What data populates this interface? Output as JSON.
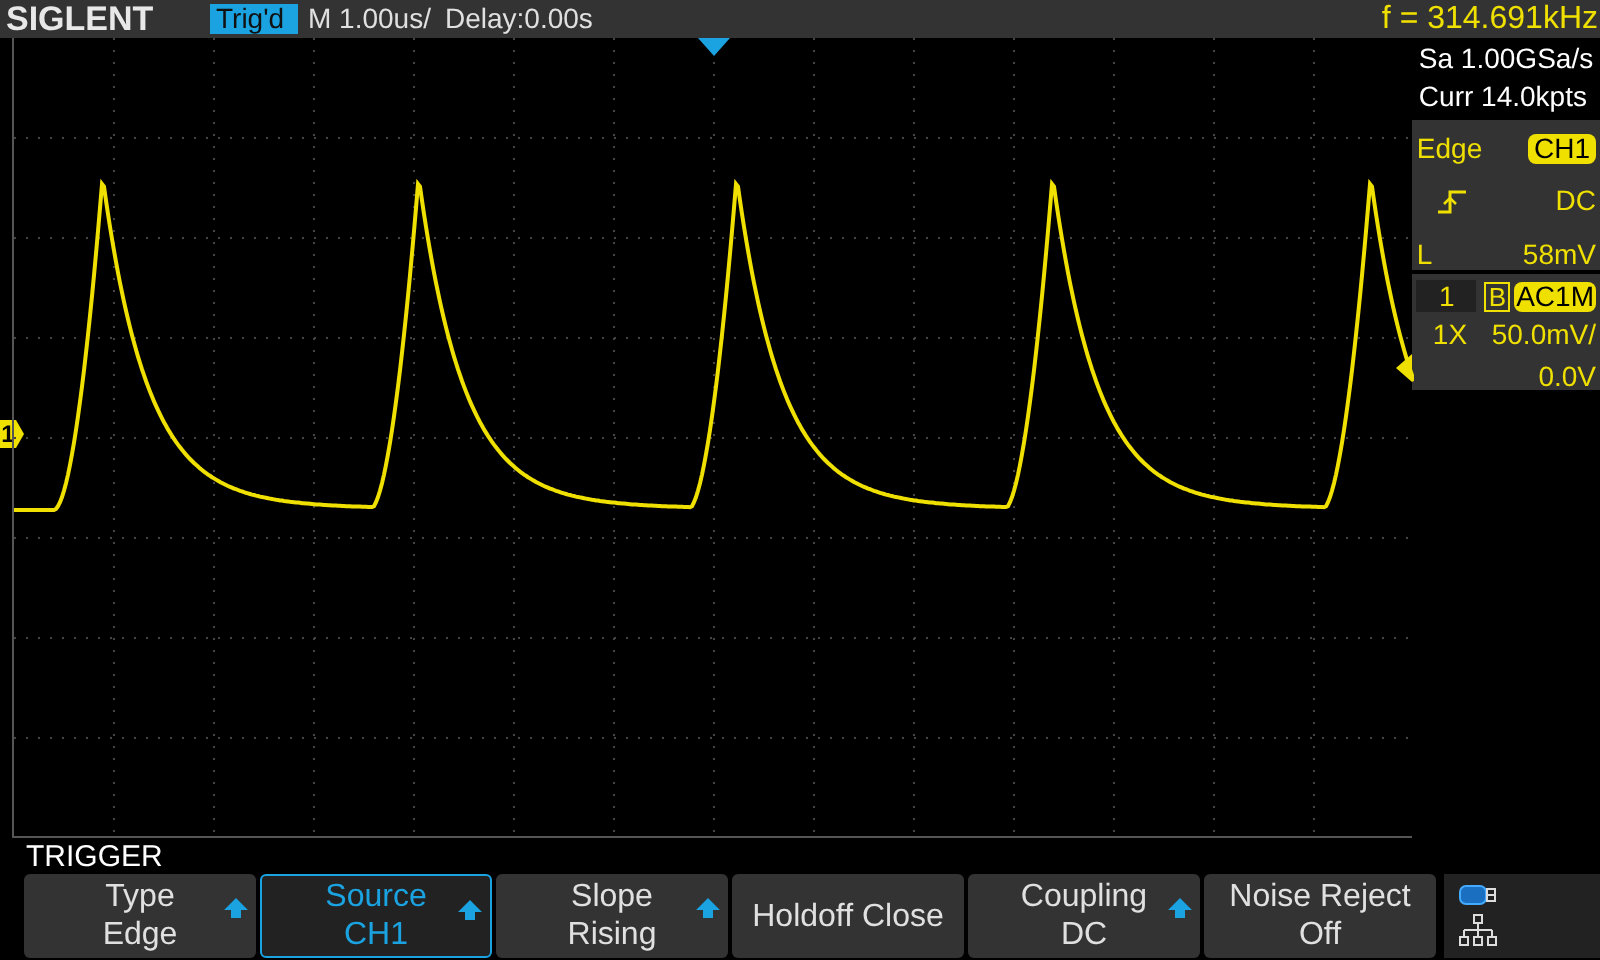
{
  "header": {
    "logo": "SIGLENT",
    "status": "Trig'd",
    "timebase": "M 1.00us/",
    "delay": "Delay:0.00s",
    "frequency": "f = 314.691kHz"
  },
  "acquisition": {
    "sample_rate": "Sa 1.00GSa/s",
    "memory": "Curr 14.0kpts"
  },
  "trigger": {
    "type": "Edge",
    "source": "CH1",
    "coupling": "DC",
    "level_label": "L",
    "level_reading": "58mV"
  },
  "channel": {
    "number": "1",
    "bandwidth_limit": "B",
    "coupling": "AC1M",
    "probe": "1X",
    "scale": "50.0mV/",
    "offset": "0.0V"
  },
  "ground_marker": "1",
  "menu": {
    "title": "TRIGGER",
    "softkeys": [
      {
        "label": "Type",
        "value": "Edge",
        "arrow": true,
        "selected": false
      },
      {
        "label": "Source",
        "value": "CH1",
        "arrow": true,
        "selected": true
      },
      {
        "label": "Slope",
        "value": "Rising",
        "arrow": true,
        "selected": false
      },
      {
        "label": "Holdoff Close",
        "arrow": false,
        "selected": false
      },
      {
        "label": "Coupling",
        "value": "DC",
        "arrow": true,
        "selected": false
      },
      {
        "label": "Noise Reject",
        "value": "Off",
        "arrow": false,
        "selected": false
      }
    ]
  }
}
